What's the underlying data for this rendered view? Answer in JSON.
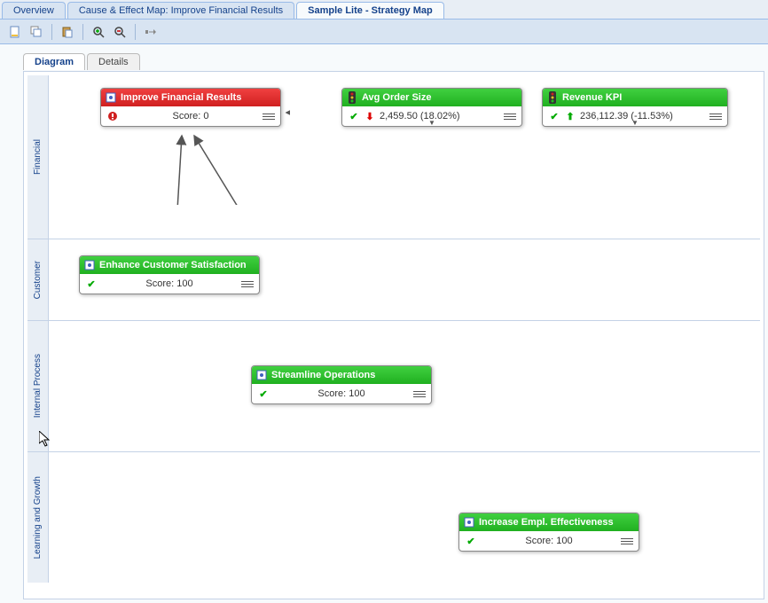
{
  "tabs": {
    "main": [
      {
        "label": "Overview",
        "active": false
      },
      {
        "label": "Cause & Effect Map: Improve Financial Results",
        "active": false
      },
      {
        "label": "Sample Lite - Strategy Map",
        "active": true
      }
    ],
    "sub": [
      {
        "label": "Diagram",
        "active": true
      },
      {
        "label": "Details",
        "active": false
      }
    ]
  },
  "toolbar": {
    "new_doc": "new-document",
    "copy": "copy",
    "paste": "paste",
    "zoom_in": "zoom-in",
    "zoom_out": "zoom-out",
    "expand": "expand-all"
  },
  "lanes": {
    "financial": "Financial",
    "customer": "Customer",
    "process": "Internal Process",
    "learning": "Learning and Growth"
  },
  "nodes": {
    "improve": {
      "title": "Improve Financial Results",
      "score_text": "Score: 0",
      "color": "red",
      "status": "alert"
    },
    "avg_order": {
      "title": "Avg Order Size",
      "value": "2,459.50 (18.02%)",
      "color": "green",
      "status": "check",
      "trend": "down"
    },
    "revenue": {
      "title": "Revenue KPI",
      "value": "236,112.39 (-11.53%)",
      "color": "green",
      "status": "check",
      "trend": "up"
    },
    "enhance": {
      "title": "Enhance Customer Satisfaction",
      "score_text": "Score: 100",
      "color": "green",
      "status": "check"
    },
    "streamline": {
      "title": "Streamline Operations",
      "score_text": "Score: 100",
      "color": "green",
      "status": "check"
    },
    "increase": {
      "title": "Increase Empl. Effectiveness",
      "score_text": "Score: 100",
      "color": "green",
      "status": "check"
    }
  }
}
